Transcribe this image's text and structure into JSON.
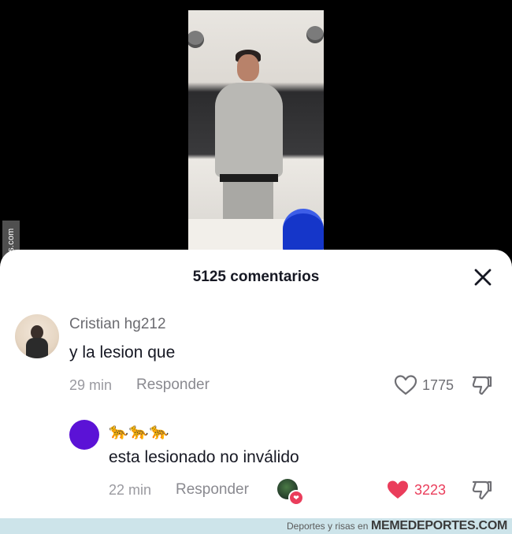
{
  "watermark": {
    "side_text": "Memedeportes.com"
  },
  "sheet": {
    "title": "5125 comentarios"
  },
  "comments": [
    {
      "username": "Cristian hg212",
      "text": "y la lesion que",
      "time": "29 min",
      "reply_label": "Responder",
      "likes": "1775"
    },
    {
      "username": "🐆🐆🐆",
      "text": "esta lesionado no inválido",
      "time": "22 min",
      "reply_label": "Responder",
      "likes": "3223"
    }
  ],
  "footer": {
    "prefix": "Deportes y risas en",
    "brand": "MEMEDEPORTES.COM"
  },
  "colors": {
    "liked": "#ea3d5b",
    "avatar_purple": "#5b12d6",
    "footer_bg": "#cde4ea"
  },
  "icons": [
    "close-icon",
    "heart-outline-icon",
    "heart-filled-icon",
    "thumbs-down-icon"
  ]
}
